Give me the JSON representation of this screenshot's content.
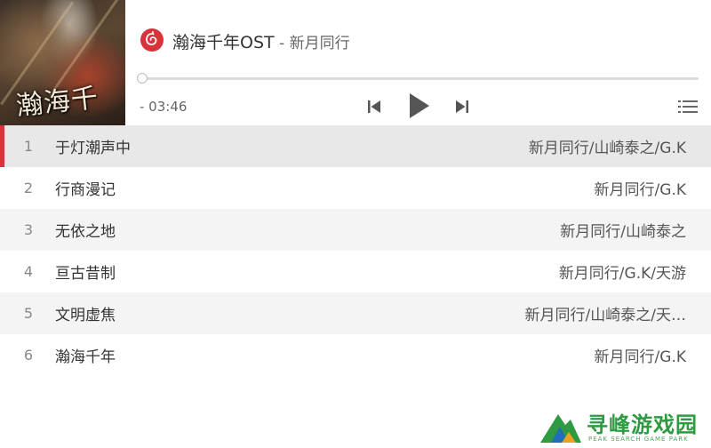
{
  "player": {
    "cover_title": "瀚海千年",
    "cover_tag": "",
    "track_name": "瀚海千年OST",
    "separator": " - ",
    "artist": "新月同行",
    "time_remaining": "- 03:46",
    "progress_fraction": 0.0,
    "accent_color": "#d8333a"
  },
  "playlist": {
    "tracks": [
      {
        "index": "1",
        "title": "于灯潮声中",
        "artists": "新月同行/山崎泰之/G.K",
        "active": true
      },
      {
        "index": "2",
        "title": "行商漫记",
        "artists": "新月同行/G.K",
        "active": false
      },
      {
        "index": "3",
        "title": "无依之地",
        "artists": "新月同行/山崎泰之",
        "active": false
      },
      {
        "index": "4",
        "title": "亘古昔制",
        "artists": "新月同行/G.K/天游",
        "active": false
      },
      {
        "index": "5",
        "title": "文明虚焦",
        "artists": "新月同行/山崎泰之/天…",
        "active": false
      },
      {
        "index": "6",
        "title": "瀚海千年",
        "artists": "新月同行/G.K",
        "active": false
      }
    ]
  },
  "watermark": {
    "name": "寻峰游戏园",
    "subtitle": "PEAK SEARCH GAME PARK",
    "color": "#2f9a42"
  },
  "icons": {
    "logo": "netease-music-logo-icon",
    "prev": "previous-track-icon",
    "play": "play-icon",
    "next": "next-track-icon",
    "list": "playlist-menu-icon"
  }
}
